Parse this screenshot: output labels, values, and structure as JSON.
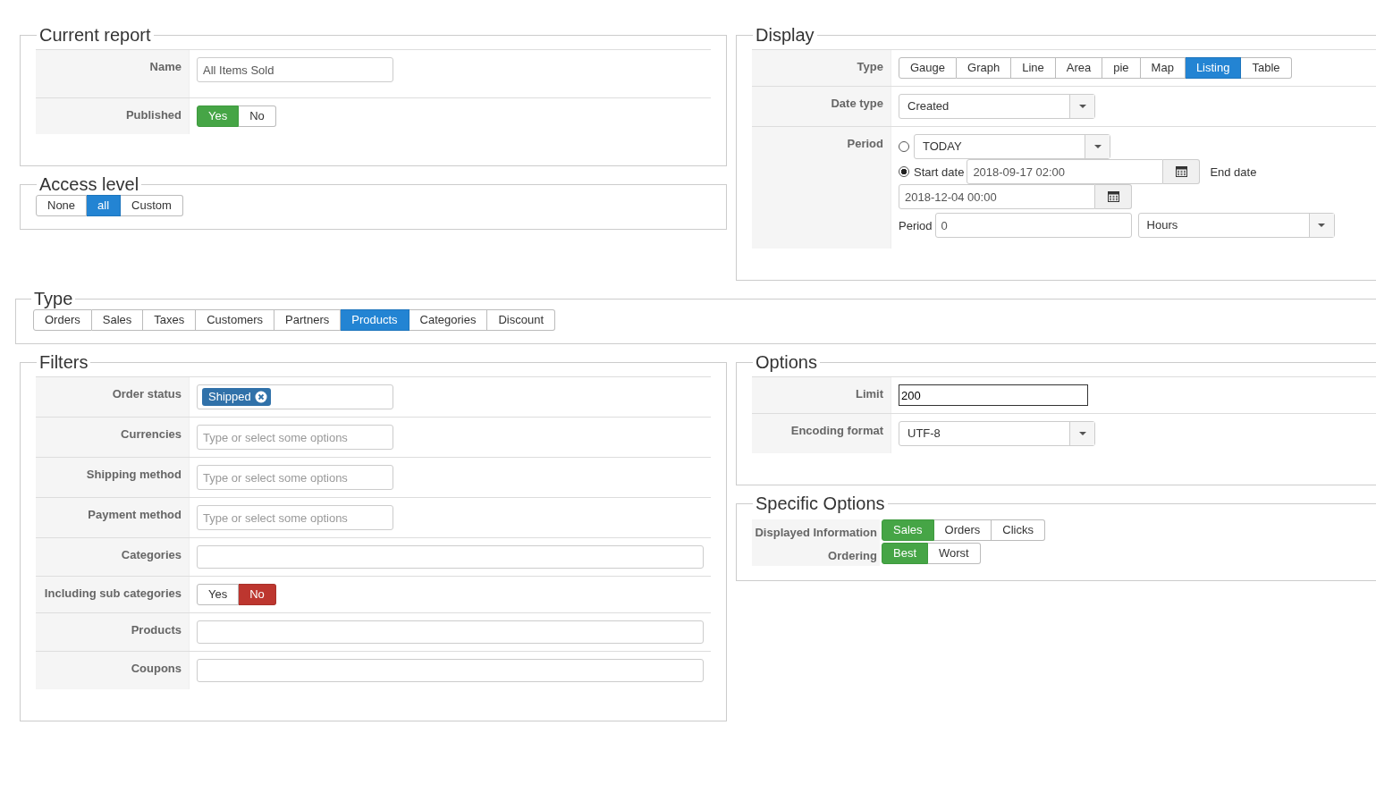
{
  "current_report": {
    "title": "Current report",
    "rows": [
      {
        "kind": "text",
        "label": "Name",
        "value": "All Items Sold"
      },
      {
        "kind": "toggle",
        "label": "Published",
        "options": [
          {
            "label": "Yes",
            "selected": true
          },
          {
            "label": "No",
            "selected": false
          }
        ]
      }
    ]
  },
  "access_level": {
    "title": "Access level",
    "options": [
      {
        "label": "None",
        "selected": false
      },
      {
        "label": "all",
        "selected": true
      },
      {
        "label": "Custom",
        "selected": false
      }
    ]
  },
  "display": {
    "title": "Display",
    "rows": [
      {
        "kind": "toggle",
        "label": "Type",
        "options": [
          {
            "label": "Gauge",
            "selected": false
          },
          {
            "label": "Graph",
            "selected": false
          },
          {
            "label": "Line",
            "selected": false
          },
          {
            "label": "Area",
            "selected": false
          },
          {
            "label": "pie",
            "selected": false
          },
          {
            "label": "Map",
            "selected": false
          },
          {
            "label": "Listing",
            "selected": true
          },
          {
            "label": "Table",
            "selected": false
          }
        ]
      },
      {
        "kind": "dropdown",
        "label": "Date type",
        "value": "Created"
      },
      {
        "kind": "period",
        "label": "Period",
        "relative": {
          "selected": false,
          "value": "TODAY"
        },
        "range": {
          "selected": true,
          "start_label": "Start date",
          "start": "2018-09-17 02:00",
          "end_label": "End date",
          "end": "2018-12-04 00:00"
        },
        "period_label": "Period",
        "period_value": "0",
        "unit": "Hours"
      }
    ]
  },
  "type": {
    "title": "Type",
    "options": [
      {
        "label": "Orders",
        "selected": false
      },
      {
        "label": "Sales",
        "selected": false
      },
      {
        "label": "Taxes",
        "selected": false
      },
      {
        "label": "Customers",
        "selected": false
      },
      {
        "label": "Partners",
        "selected": false
      },
      {
        "label": "Products",
        "selected": true
      },
      {
        "label": "Categories",
        "selected": false
      },
      {
        "label": "Discount",
        "selected": false
      }
    ]
  },
  "filters": {
    "title": "Filters",
    "rows": [
      {
        "kind": "tags",
        "label": "Order status",
        "tags": [
          "Shipped"
        ]
      },
      {
        "kind": "multiselect",
        "label": "Currencies",
        "placeholder": "Type or select some options"
      },
      {
        "kind": "multiselect",
        "label": "Shipping method",
        "placeholder": "Type or select some options"
      },
      {
        "kind": "multiselect",
        "label": "Payment method",
        "placeholder": "Type or select some options"
      },
      {
        "kind": "wide",
        "label": "Categories"
      },
      {
        "kind": "toggle",
        "label": "Including sub categories",
        "options": [
          {
            "label": "Yes",
            "selected": false
          },
          {
            "label": "No",
            "selected": true
          }
        ]
      },
      {
        "kind": "wide",
        "label": "Products"
      },
      {
        "kind": "wide",
        "label": "Coupons"
      }
    ]
  },
  "options": {
    "title": "Options",
    "rows": [
      {
        "kind": "text",
        "label": "Limit",
        "value": "200",
        "focused": true
      },
      {
        "kind": "dropdown",
        "label": "Encoding format",
        "value": "UTF-8"
      }
    ]
  },
  "specific_options": {
    "title": "Specific Options",
    "rows": [
      {
        "kind": "toggle",
        "label": "Displayed Information",
        "options": [
          {
            "label": "Sales",
            "selected": true
          },
          {
            "label": "Orders",
            "selected": false
          },
          {
            "label": "Clicks",
            "selected": false
          }
        ]
      },
      {
        "kind": "toggle",
        "label": "Ordering",
        "options": [
          {
            "label": "Best",
            "selected": true
          },
          {
            "label": "Worst",
            "selected": false
          }
        ]
      }
    ]
  }
}
